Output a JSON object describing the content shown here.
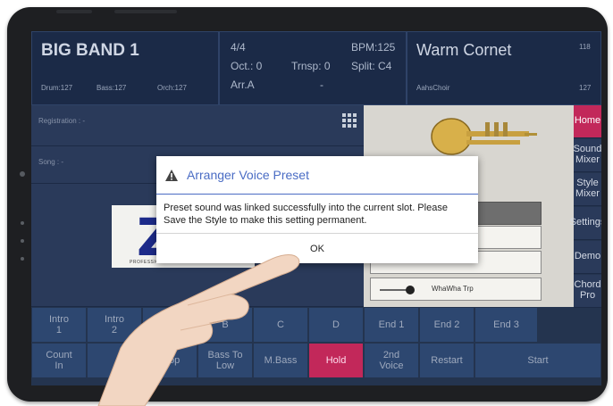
{
  "header": {
    "style_name": "BIG BAND 1",
    "drum": "Drum:127",
    "bass": "Bass:127",
    "orch": "Orch:127",
    "time_sig": "4/4",
    "octave": "Oct.: 0",
    "transpose": "Trnsp: 0",
    "arrangement": "Arr.A",
    "dash": "-",
    "bpm": "BPM:125",
    "split": "Split: C4",
    "voice_name": "Warm Cornet",
    "voice_num": "118",
    "voice_sub": "AahsChoir",
    "voice_vol": "127"
  },
  "panels": {
    "registration": "Registration : -",
    "song": "Song : -"
  },
  "logo": {
    "letter": "Z",
    "tagline": "PROFESSIONAL ARRANGER"
  },
  "instruments": {
    "voice_3": "WhaWha Trp"
  },
  "right_buttons": [
    "Home",
    "Sound\nMixer",
    "Style\nMixer",
    "Settings",
    "Demo",
    "Chord\nPro"
  ],
  "bottom_row1": [
    "Intro\n1",
    "Intro\n2",
    "",
    "B",
    "C",
    "D",
    "End 1",
    "End 2",
    "End 3"
  ],
  "bottom_row2": [
    "Count\nIn",
    "",
    "Stop",
    "Bass To\nLow",
    "M.Bass",
    "Hold",
    "2nd\nVoice",
    "Restart",
    "Start"
  ],
  "dialog": {
    "title": "Arranger Voice Preset",
    "message": "Preset sound was linked successfully into the current slot. Please Save the Style to make this setting permanent.",
    "ok_label": "OK"
  },
  "colors": {
    "home_active": "#c2285a",
    "hold_active": "#c2285a",
    "dialog_accent": "#4a6cc4"
  }
}
